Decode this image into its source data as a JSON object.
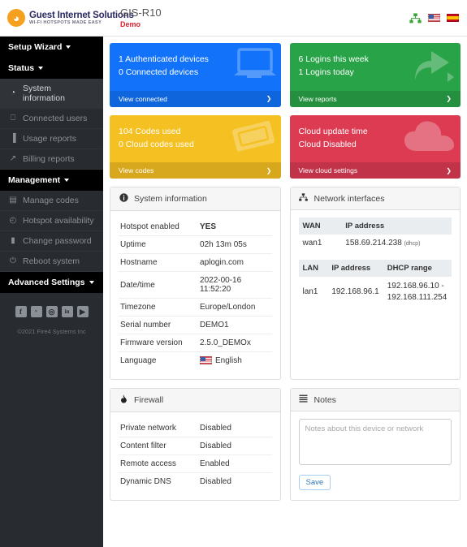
{
  "header": {
    "brand_name": "Guest Internet Solutions",
    "brand_tagline": "WI-FI HOTSPOTS MADE EASY",
    "device_model": "GIS-R10",
    "device_status": "Demo",
    "sitemap_icon": "sitemap-icon",
    "flag_en": "flag-usa-icon",
    "flag_es": "flag-spain-icon"
  },
  "sidebar": {
    "sections": [
      {
        "label": "Setup Wizard",
        "items": []
      },
      {
        "label": "Status",
        "items": [
          {
            "label": "System information",
            "icon": "dashboard-icon",
            "glyph": "◔",
            "active": true
          },
          {
            "label": "Connected users",
            "icon": "monitor-icon",
            "glyph": "⎕",
            "active": false
          },
          {
            "label": "Usage reports",
            "icon": "bar-chart-icon",
            "glyph": "▐",
            "active": false
          },
          {
            "label": "Billing reports",
            "icon": "line-chart-icon",
            "glyph": "↗",
            "active": false
          }
        ]
      },
      {
        "label": "Management",
        "items": [
          {
            "label": "Manage codes",
            "icon": "ticket-icon",
            "glyph": "▤",
            "active": false
          },
          {
            "label": "Hotspot availability",
            "icon": "clock-icon",
            "glyph": "◴",
            "active": false
          },
          {
            "label": "Change password",
            "icon": "lock-icon",
            "glyph": "▮",
            "active": false
          },
          {
            "label": "Reboot system",
            "icon": "power-icon",
            "glyph": "⏻",
            "active": false
          }
        ]
      },
      {
        "label": "Advanced Settings",
        "items": []
      }
    ],
    "social": [
      {
        "name": "facebook-icon",
        "glyph": "f"
      },
      {
        "name": "twitter-icon",
        "glyph": "ᵛ"
      },
      {
        "name": "instagram-icon",
        "glyph": "◎"
      },
      {
        "name": "linkedin-icon",
        "glyph": "in"
      },
      {
        "name": "youtube-icon",
        "glyph": "▶"
      }
    ],
    "copyright": "©2021 Fire4 Systems Inc"
  },
  "stat_cards": [
    {
      "name": "authenticated-devices-card",
      "color": "#1273fa",
      "line1": "1 Authenticated devices",
      "line2": "0 Connected devices",
      "footer": "View connected",
      "art": "laptop-icon"
    },
    {
      "name": "logins-card",
      "color": "#29a347",
      "line1": "6 Logins this week",
      "line2": "1 Logins today",
      "footer": "View reports",
      "art": "share-arrow-icon"
    },
    {
      "name": "codes-card",
      "color": "#f5c022",
      "line1": "104 Codes used",
      "line2": "0 Cloud codes used",
      "footer": "View codes",
      "art": "ticket-icon"
    },
    {
      "name": "cloud-card",
      "color": "#dc3b52",
      "line1": "Cloud update time",
      "line2": "Cloud Disabled",
      "footer": "View cloud settings",
      "art": "cloud-icon"
    }
  ],
  "system_information": {
    "title": "System information",
    "icon": "info-circle-icon",
    "rows": [
      {
        "key": "Hotspot enabled",
        "value": "YES",
        "style": "green"
      },
      {
        "key": "Uptime",
        "value": "02h 13m 05s",
        "style": "plain"
      },
      {
        "key": "Hostname",
        "value": "aplogin.com",
        "style": "link"
      },
      {
        "key": "Date/time",
        "value": "2022-00-16 11:52:20",
        "style": "plain"
      },
      {
        "key": "Timezone",
        "value": "Europe/London",
        "style": "link"
      },
      {
        "key": "Serial number",
        "value": "DEMO1",
        "style": "plain"
      },
      {
        "key": "Firmware version",
        "value": "2.5.0_DEMOx",
        "style": "link"
      },
      {
        "key": "Language",
        "value": "English",
        "style": "flag"
      }
    ]
  },
  "network_interfaces": {
    "title": "Network interfaces",
    "icon": "sitemap-icon",
    "wan": {
      "headers": [
        "WAN",
        "IP address"
      ],
      "iface": "wan1",
      "ip": "158.69.214.238",
      "mode": "(dhcp)"
    },
    "lan": {
      "headers": [
        "LAN",
        "IP address",
        "DHCP range"
      ],
      "iface": "lan1",
      "ip": "192.168.96.1",
      "range": "192.168.96.10 - 192.168.111.254"
    }
  },
  "firewall": {
    "title": "Firewall",
    "icon": "flame-icon",
    "rows": [
      {
        "key": "Private network",
        "value": "Disabled"
      },
      {
        "key": "Content filter",
        "value": "Disabled"
      },
      {
        "key": "Remote access",
        "value": "Enabled"
      },
      {
        "key": "Dynamic DNS",
        "value": "Disabled"
      }
    ]
  },
  "notes": {
    "title": "Notes",
    "icon": "list-icon",
    "placeholder": "Notes about this device or network",
    "value": "",
    "save_label": "Save"
  }
}
